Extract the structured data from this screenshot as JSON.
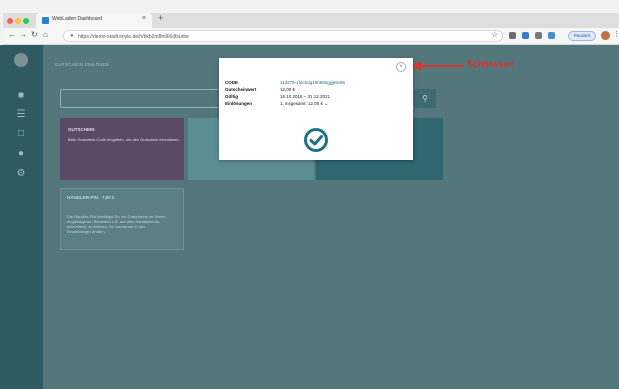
{
  "browser": {
    "tab_title": "WebLaden Dashboard",
    "tab_close_label": "×",
    "new_tab_label": "+",
    "url": "https://demo-stadt.imyle.de/h/bkb2m8m9i6dfsurbe",
    "paused_label": "Pausiert",
    "colors": {
      "traffic_red": "#fc605c",
      "traffic_yellow": "#fdbc40",
      "traffic_green": "#34c84a"
    }
  },
  "sidebar": {
    "icons": [
      "logo-icon",
      "store-icon",
      "list-icon",
      "document-icon",
      "users-icon",
      "gear-icon"
    ]
  },
  "main": {
    "breadcrumb": "GUTSCHEIN EINLÖSEN",
    "cards": [
      {
        "title": "GUTSCHEIN",
        "text": "Bitte Gutschein-Code eingeben, um den Gutschein einzulösen.",
        "color": "#5a4a67"
      },
      {
        "title": "",
        "text": "",
        "color": "#5c8f95"
      },
      {
        "title": "",
        "text": "",
        "color": "#2f6670"
      }
    ],
    "haendler": {
      "title": "HÄNDLER-PIN · 7,50 €",
      "text": "Die Händler-PIN benötigst Du um Gutscheine im Verein eingetragenen Betrieben z.B. auf dem Kundenkonto, einzulösen, zu können. Du kannst sie in den Einstellungen ändern."
    }
  },
  "modal": {
    "code_label": "CODE",
    "code_value": "113279-1f4cbdg19h685gjjje8c96",
    "value_label": "Gutscheinwert",
    "value_value": "12,00 €",
    "valid_label": "Gültig",
    "valid_value": "15.10.2018 – 31.12.2021",
    "redemptions_label": "Einlösungen",
    "redemptions_value": "1, insgesamt: 12,00 €",
    "close_label": "×",
    "check_color": "#1f6f86"
  },
  "annotation": {
    "text": "Schliessen",
    "color": "#e03030"
  }
}
